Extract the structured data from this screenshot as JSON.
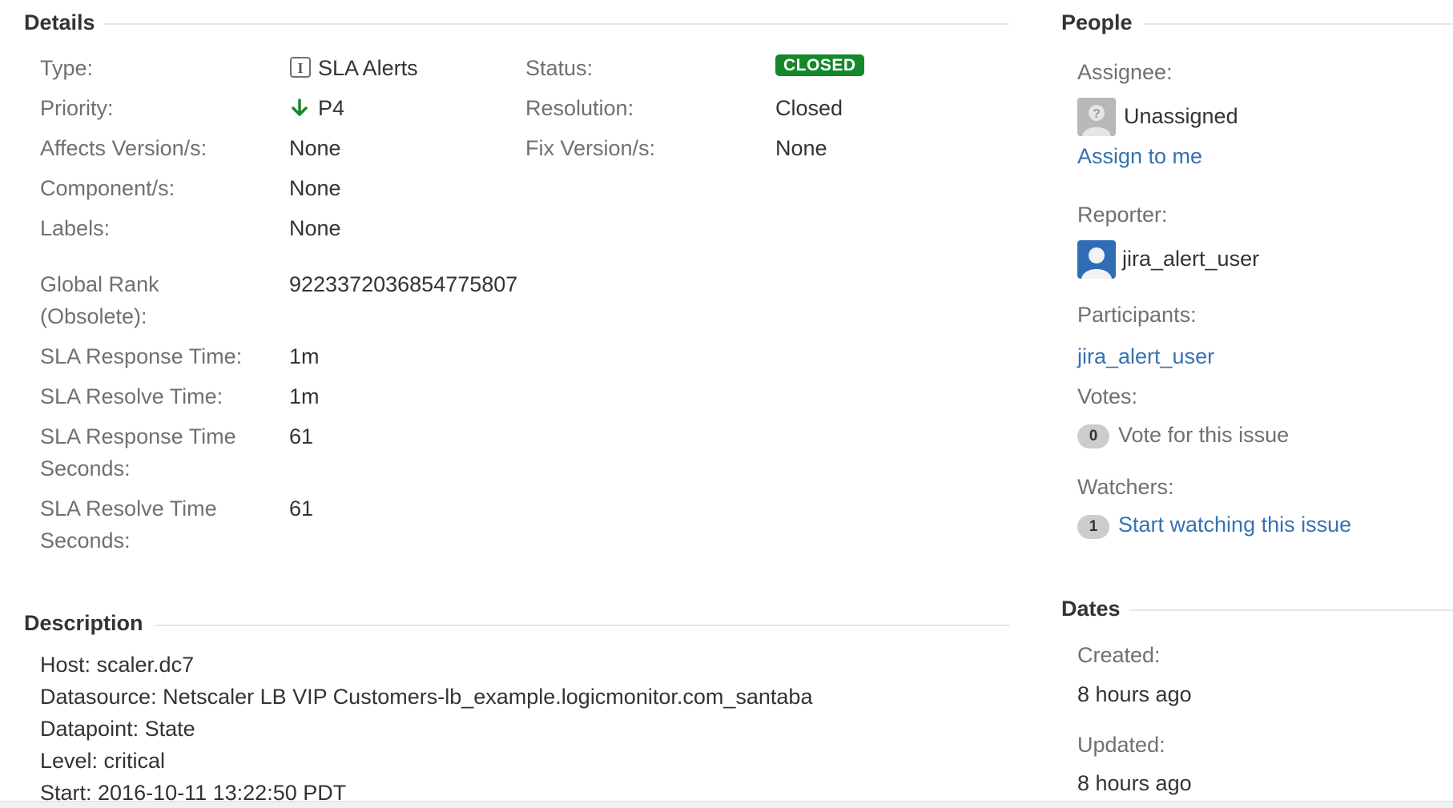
{
  "details": {
    "title": "Details",
    "type": {
      "label": "Type:",
      "value": "SLA Alerts",
      "icon": "sla-issue-type-icon"
    },
    "priority": {
      "label": "Priority:",
      "value": "P4",
      "icon": "arrow-down-icon"
    },
    "affects": {
      "label": "Affects Version/s:",
      "value": "None"
    },
    "components": {
      "label": "Component/s:",
      "value": "None"
    },
    "labels": {
      "label": "Labels:",
      "value": "None"
    },
    "status": {
      "label": "Status:",
      "value": "CLOSED"
    },
    "resolution": {
      "label": "Resolution:",
      "value": "Closed"
    },
    "fix_version": {
      "label": "Fix Version/s:",
      "value": "None"
    },
    "global_rank": {
      "label_line1": "Global Rank",
      "label_line2": "(Obsolete):",
      "value": "9223372036854775807"
    },
    "sla_response_time": {
      "label": "SLA Response Time:",
      "value": "1m"
    },
    "sla_resolve_time": {
      "label": "SLA Resolve Time:",
      "value": "1m"
    },
    "sla_response_seconds": {
      "label_line1": "SLA Response Time",
      "label_line2": "Seconds:",
      "value": "61"
    },
    "sla_resolve_seconds": {
      "label_line1": "SLA Resolve Time",
      "label_line2": "Seconds:",
      "value": "61"
    }
  },
  "description": {
    "title": "Description",
    "lines": [
      "Host: scaler.dc7",
      "Datasource: Netscaler LB VIP Customers-lb_example.logicmonitor.com_santaba",
      "Datapoint: State",
      "Level: critical",
      "Start: 2016-10-11 13:22:50 PDT"
    ]
  },
  "people": {
    "title": "People",
    "assignee_label": "Assignee:",
    "assignee_value": "Unassigned",
    "assign_to_me": "Assign to me",
    "reporter_label": "Reporter:",
    "reporter_value": "jira_alert_user",
    "participants_label": "Participants:",
    "participants_value": "jira_alert_user",
    "votes_label": "Votes:",
    "votes_count": "0",
    "vote_link": "Vote for this issue",
    "watchers_label": "Watchers:",
    "watchers_count": "1",
    "watch_link": "Start watching this issue"
  },
  "dates": {
    "title": "Dates",
    "created_label": "Created:",
    "created_value": "8 hours ago",
    "updated_label": "Updated:",
    "updated_value": "8 hours ago"
  },
  "colors": {
    "link": "#3572b0",
    "status_closed": "#14892c",
    "priority_arrow": "#14892c"
  }
}
